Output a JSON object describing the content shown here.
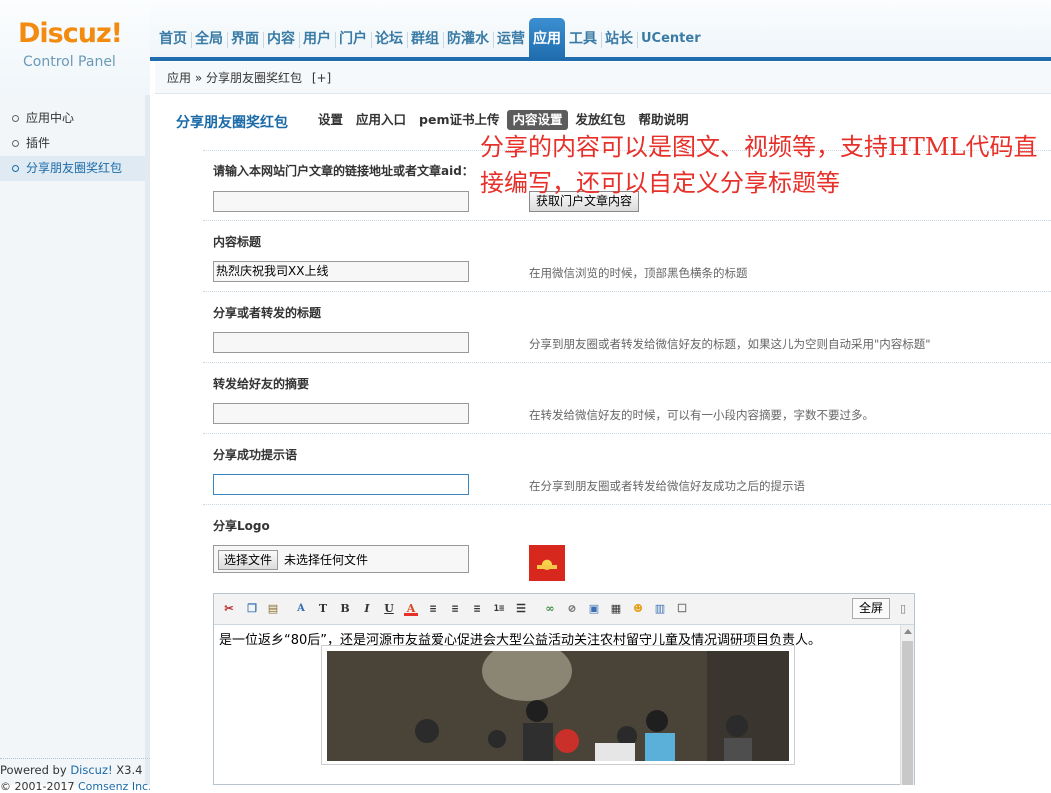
{
  "header": {
    "logo_text": "Discuz!",
    "logo_sub": "Control Panel",
    "nav": [
      "首页",
      "全局",
      "界面",
      "内容",
      "用户",
      "门户",
      "论坛",
      "群组",
      "防灌水",
      "运营",
      "应用",
      "工具",
      "站长",
      "UCenter"
    ],
    "active_nav": "应用"
  },
  "breadcrumb": {
    "path": "应用 » 分享朋友圈奖红包",
    "add": "[+]"
  },
  "sidebar": {
    "items": [
      "应用中心",
      "插件",
      "分享朋友圈奖红包"
    ],
    "active": "分享朋友圈奖红包",
    "powered_prefix": "Powered by ",
    "powered_brand": "Discuz!",
    "powered_version": " X3.4",
    "copyright_prefix": "© 2001-2017 ",
    "copyright_company": "Comsenz Inc."
  },
  "plugin": {
    "title": "分享朋友圈奖红包",
    "tabs": [
      "设置",
      "应用入口",
      "pem证书上传",
      "内容设置",
      "发放红包",
      "帮助说明"
    ],
    "active_tab": "内容设置"
  },
  "annotation": "分享的内容可以是图文、视频等，支持HTML代码直接编写，还可以自定义分享标题等",
  "form": {
    "article_label": "请输入本网站门户文章的链接地址或者文章aid：",
    "article_value": "",
    "fetch_button": "获取门户文章内容",
    "content_title_label": "内容标题",
    "content_title_value": "热烈庆祝我司XX上线",
    "content_title_hint": "在用微信浏览的时候，顶部黑色横条的标题",
    "share_title_label": "分享或者转发的标题",
    "share_title_value": "",
    "share_title_hint": "分享到朋友圈或者转发给微信好友的标题，如果这儿为空则自动采用\"内容标题\"",
    "summary_label": "转发给好友的摘要",
    "summary_value": "",
    "summary_hint": "在转发给微信好友的时候，可以有一小段内容摘要，字数不要过多。",
    "success_label": "分享成功提示语",
    "success_value": "",
    "success_hint": "在分享到朋友圈或者转发给微信好友成功之后的提示语",
    "logo_label": "分享Logo",
    "file_button": "选择文件",
    "file_status": "未选择任何文件"
  },
  "editor": {
    "fullscreen": "全屏",
    "content_text": "是一位返乡“80后”，还是河源市友益爱心促进会大型公益活动关注农村留守儿童及情况调研项目负责人。"
  },
  "colors": {
    "accent": "#1a6aa8",
    "nav_active": "#2a7cc0",
    "annotation": "#e8302a",
    "logo_orange": "#f48b11"
  }
}
